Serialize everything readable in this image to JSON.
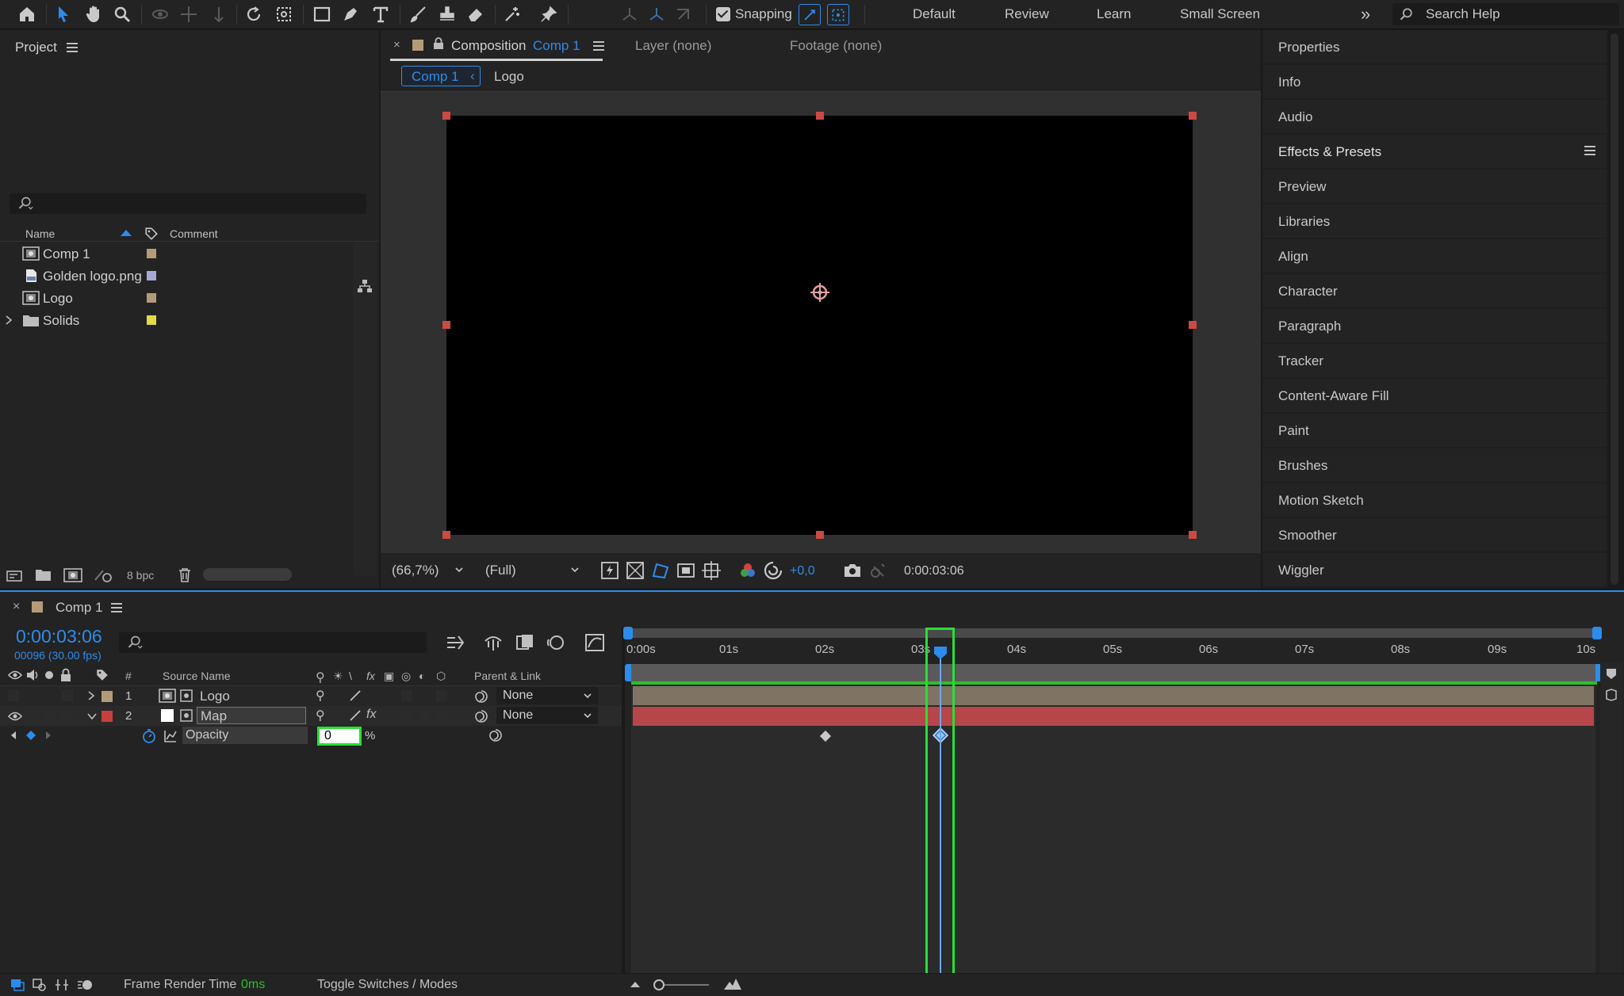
{
  "toolbar": {
    "tools": [
      "home-icon",
      "selection-tool-icon",
      "hand-tool-icon",
      "zoom-tool-icon",
      "orbit-camera-icon",
      "pan-camera-icon",
      "dolly-camera-icon",
      "rotate-tool-icon",
      "pan-behind-icon",
      "rectangle-tool-icon",
      "pen-tool-icon",
      "type-tool-icon",
      "brush-tool-icon",
      "clone-stamp-icon",
      "eraser-tool-icon",
      "roto-brush-icon",
      "puppet-pin-icon"
    ],
    "snapping_label": "Snapping",
    "snapping_checked": true,
    "workspaces": [
      "Default",
      "Review",
      "Learn",
      "Small Screen"
    ],
    "more": "»",
    "search_placeholder": "Search Help"
  },
  "project": {
    "title": "Project",
    "columns": {
      "name": "Name",
      "comment": "Comment"
    },
    "items": [
      {
        "name": "Comp 1",
        "type": "composition",
        "label_color": "#b49b78"
      },
      {
        "name": "Golden logo.png",
        "type": "image",
        "label_color": "#a8a7d6"
      },
      {
        "name": "Logo",
        "type": "composition",
        "label_color": "#b49b78"
      },
      {
        "name": "Solids",
        "type": "folder",
        "label_color": "#e3d947"
      }
    ],
    "bpc": "8 bpc"
  },
  "composition": {
    "tab_close": "×",
    "tab_label": "Composition",
    "tab_name": "Comp 1",
    "layer_tab": "Layer (none)",
    "footage_tab": "Footage (none)",
    "breadcrumb": [
      "Comp 1",
      "Logo"
    ],
    "crumb_arrow": "‹",
    "zoom": "(66,7%)",
    "resolution": "(Full)",
    "exposure": "+0,0",
    "current_time": "0:00:03:06"
  },
  "right_panels": [
    "Properties",
    "Info",
    "Audio",
    "Effects & Presets",
    "Preview",
    "Libraries",
    "Align",
    "Character",
    "Paragraph",
    "Tracker",
    "Content-Aware Fill",
    "Paint",
    "Brushes",
    "Motion Sketch",
    "Smoother",
    "Wiggler"
  ],
  "timeline": {
    "tab_close": "×",
    "tab_name": "Comp 1",
    "time": "0:00:03:06",
    "frames": "00096 (30.00 fps)",
    "columns": {
      "hash": "#",
      "source_name": "Source Name",
      "parent": "Parent & Link"
    },
    "layers": [
      {
        "num": "1",
        "name": "Logo",
        "label_color": "#b49b78",
        "parent": "None"
      },
      {
        "num": "2",
        "name": "Map",
        "label_color": "#c7403c",
        "parent": "None"
      }
    ],
    "property": {
      "name": "Opacity",
      "value": "0",
      "unit": "%"
    },
    "ruler": [
      "0:00s",
      "01s",
      "02s",
      "03s",
      "04s",
      "05s",
      "06s",
      "07s",
      "08s",
      "09s",
      "10s"
    ],
    "footer": {
      "frame_render_label": "Frame Render Time",
      "frame_render_value": "0ms",
      "toggle": "Toggle Switches / Modes"
    }
  }
}
